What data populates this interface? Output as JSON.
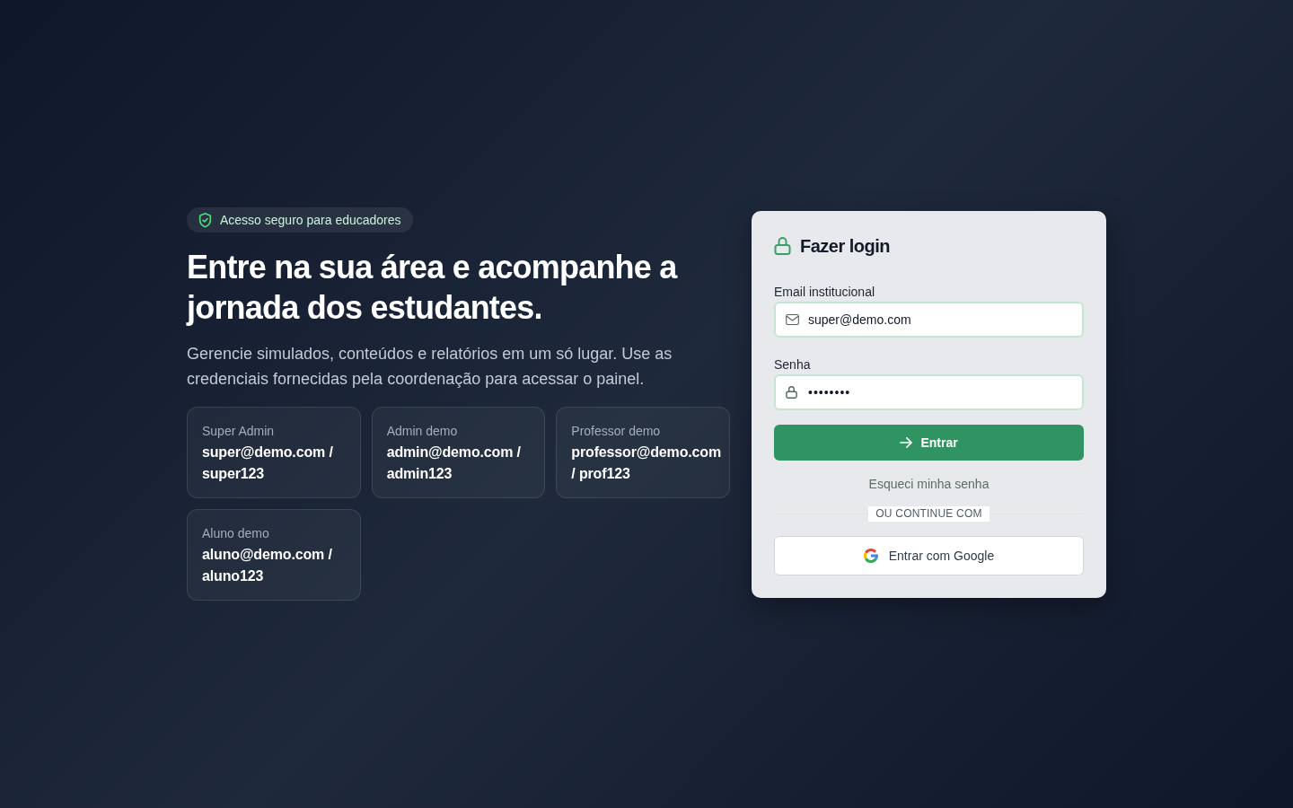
{
  "badge": {
    "label": "Acesso seguro para educadores"
  },
  "hero": {
    "title": "Entre na sua área e acompanhe a jornada dos estudantes.",
    "description": "Gerencie simulados, conteúdos e relatórios em um só lugar. Use as credenciais fornecidas pela coordenação para acessar o painel."
  },
  "demo_accounts": [
    {
      "role": "Super Admin",
      "credentials": "super@demo.com / super123"
    },
    {
      "role": "Admin demo",
      "credentials": "admin@demo.com / admin123"
    },
    {
      "role": "Professor demo",
      "credentials": "professor@demo.com / prof123"
    },
    {
      "role": "Aluno demo",
      "credentials": "aluno@demo.com / aluno123"
    }
  ],
  "login": {
    "title": "Fazer login",
    "fields": [
      {
        "kind": "email",
        "label": "Email institucional",
        "value": "super@demo.com"
      },
      {
        "kind": "password",
        "label": "Senha",
        "value": "••••••••"
      }
    ],
    "submit_button": {
      "label": "Entrar"
    },
    "forgot_link": "Esqueci minha senha",
    "divider": "OU CONTINUE COM",
    "google_button": {
      "label": "Entrar com Google"
    }
  }
}
